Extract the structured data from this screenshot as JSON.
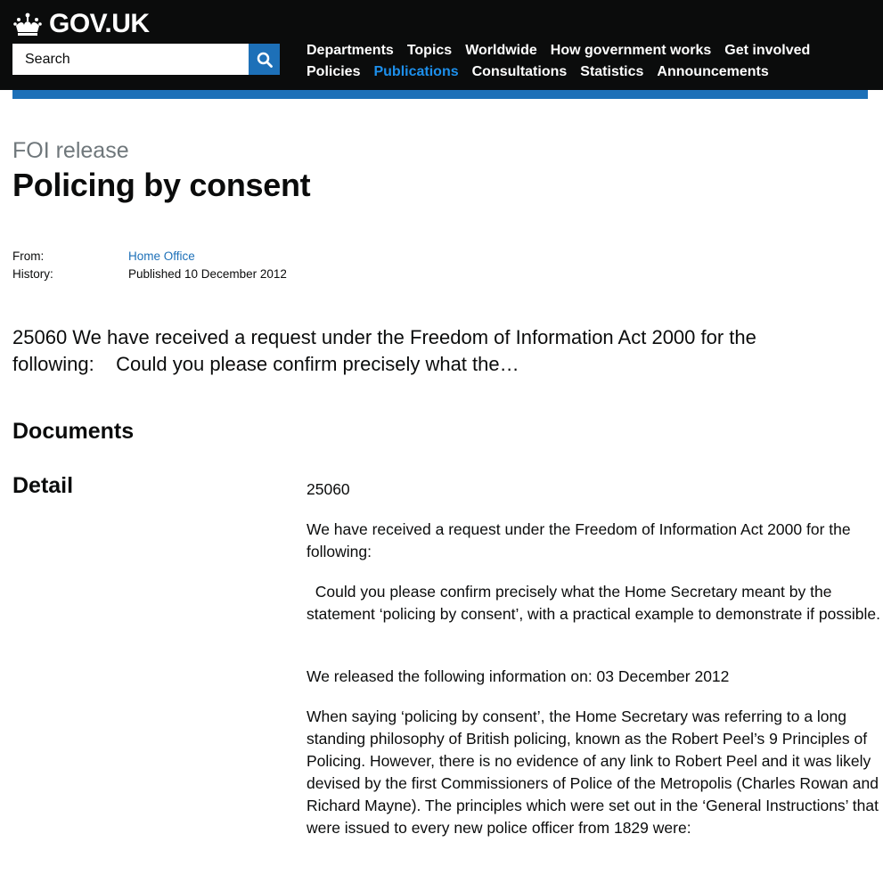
{
  "header": {
    "logo_text": "GOV.UK",
    "search_placeholder": "Search",
    "nav_row1": [
      "Departments",
      "Topics",
      "Worldwide",
      "How government works",
      "Get involved"
    ],
    "nav_row2": [
      "Policies",
      "Publications",
      "Consultations",
      "Statistics",
      "Announcements"
    ],
    "active_item": "Publications"
  },
  "page": {
    "doc_type": "FOI release",
    "title": "Policing by consent",
    "meta": {
      "from_label": "From:",
      "from_value": "Home Office",
      "history_label": "History:",
      "history_value": "Published 10 December 2012"
    },
    "summary": "25060 We have received a request under the Freedom of Information Act 2000 for the following:    Could you please confirm precisely what the…",
    "documents_heading": "Documents",
    "detail_heading": "Detail",
    "detail_paragraphs": [
      "25060",
      "We have received a request under the Freedom of Information Act 2000 for the following:",
      "  Could you please confirm precisely what the Home Secretary meant by the statement ‘policing by consent’, with a practical example to demonstrate if possible.",
      "We released the following information on: 03 December 2012",
      "When saying ‘policing by consent’, the Home Secretary was referring to a long standing philosophy of British policing, known as the Robert Peel’s 9 Principles of Policing. However, there is no evidence of any link to Robert Peel and it was likely devised by the first Commissioners of Police of the Metropolis (Charles Rowan and Richard Mayne). The principles which were set out in the ‘General Instructions’ that were issued to every new police officer from 1829 were:"
    ]
  },
  "colors": {
    "header_bg": "#0b0c0c",
    "brand_blue": "#1d70b8",
    "active_nav": "#1d8feb",
    "secondary_text": "#6f777b"
  }
}
